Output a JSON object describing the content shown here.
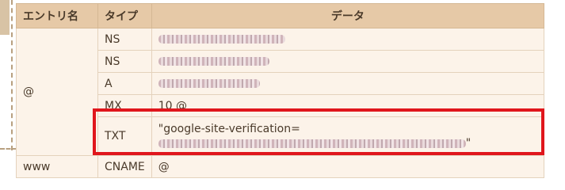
{
  "table": {
    "headers": {
      "name": "エントリ名",
      "type": "タイプ",
      "data": "データ"
    },
    "rows": [
      {
        "name": "@",
        "type": "NS",
        "data": ""
      },
      {
        "type": "NS",
        "data": ""
      },
      {
        "type": "A",
        "data": ""
      },
      {
        "type": "MX",
        "data": "10 @"
      },
      {
        "type": "TXT",
        "data_prefix": "\"google-site-verification=",
        "data_suffix": "\""
      },
      {
        "name": "www",
        "type": "CNAME",
        "data": "@"
      }
    ]
  },
  "colors": {
    "header_bg": "#e6c9a7",
    "cell_bg": "#fcf3e9",
    "highlight": "#e0161c"
  }
}
